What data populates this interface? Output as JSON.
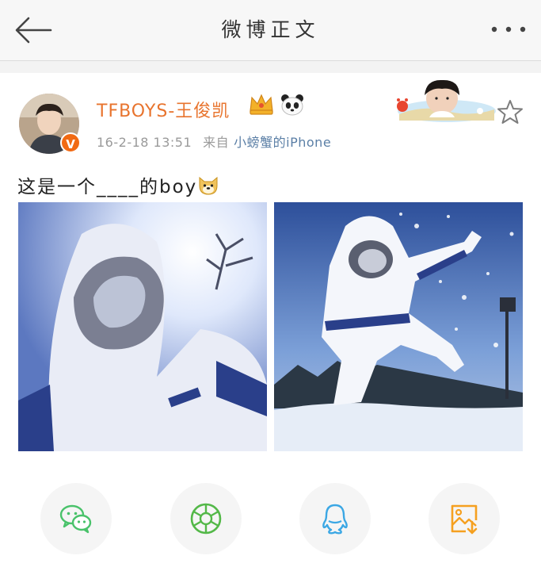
{
  "header": {
    "title": "微博正文"
  },
  "post": {
    "username": "TFBOYS-王俊凯",
    "verified_mark": "V",
    "timestamp": "16-2-18 13:51",
    "from_label": "来自",
    "source": "小螃蟹的iPhone",
    "text": "这是一个____的boy"
  },
  "icons": {
    "back": "back-arrow-icon",
    "more": "more-dots-icon",
    "crown": "crown-icon",
    "panda": "panda-icon",
    "star": "star-icon",
    "dog": "dog-face-icon",
    "share_wechat": "wechat-icon",
    "share_moments": "moments-icon",
    "share_qq": "qq-icon",
    "save_image": "save-image-icon"
  },
  "colors": {
    "username": "#e8742e",
    "source_link": "#5b7fa6",
    "wechat": "#49c26a",
    "moments": "#53b848",
    "qq": "#3ba7e4",
    "save": "#f5a020"
  }
}
